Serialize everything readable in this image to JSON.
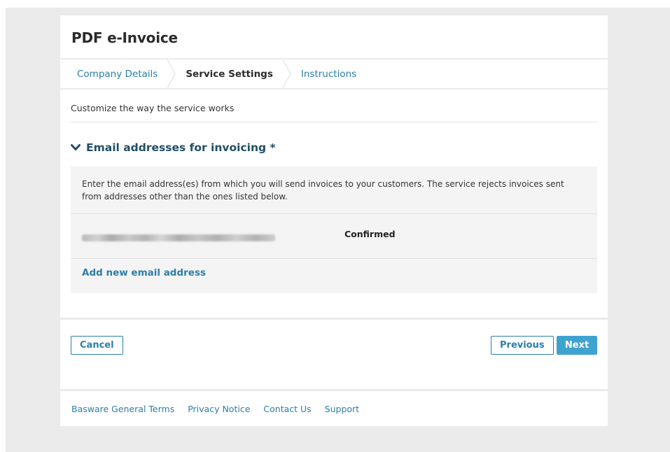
{
  "header": {
    "title": "PDF e-Invoice"
  },
  "steps": [
    {
      "label": "Company Details",
      "state": "link"
    },
    {
      "label": "Service Settings",
      "state": "active"
    },
    {
      "label": "Instructions",
      "state": "link"
    }
  ],
  "main": {
    "subtitle": "Customize the way the service works",
    "section_title": "Email addresses for invoicing *",
    "section_icon": "chevron-down-icon",
    "description": "Enter the email address(es) from which you will send invoices to your customers. The service rejects invoices sent from addresses other than the ones listed below.",
    "emails": [
      {
        "address_redacted": true,
        "status": "Confirmed"
      }
    ],
    "add_email_label": "Add new email address"
  },
  "actions": {
    "cancel_label": "Cancel",
    "previous_label": "Previous",
    "next_label": "Next"
  },
  "footer": {
    "links": [
      "Basware General Terms",
      "Privacy Notice",
      "Contact Us",
      "Support"
    ]
  },
  "colors": {
    "accent": "#2b7fa8",
    "primary_button": "#3fa3cf",
    "heading": "#1f4e66",
    "page_background": "#ebebeb",
    "panel_background": "#f4f4f4"
  }
}
